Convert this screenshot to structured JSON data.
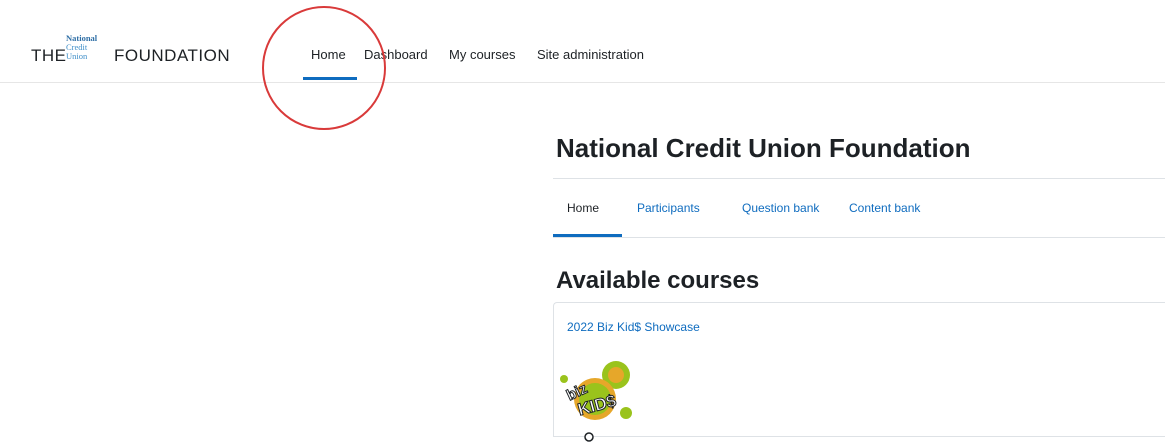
{
  "brand": {
    "the": "THE",
    "name_lines": [
      "National",
      "Credit",
      "Union"
    ],
    "foundation": "FOUNDATION"
  },
  "nav": {
    "items": [
      "Home",
      "Dashboard",
      "My courses",
      "Site administration"
    ],
    "active": "Home"
  },
  "page": {
    "title": "National Credit Union Foundation"
  },
  "secondary_nav": {
    "tabs": [
      "Home",
      "Participants",
      "Question bank",
      "Content bank"
    ],
    "active": "Home"
  },
  "courses": {
    "heading": "Available courses",
    "items": [
      {
        "name": "2022 Biz Kid$ Showcase",
        "logo_text_top": "biz",
        "logo_text_bottom": "KID$"
      }
    ]
  },
  "colors": {
    "accent": "#0f6cbf",
    "annotation": "#d93a3a",
    "logo_green": "#9ac31c",
    "logo_orange": "#e6a72a"
  }
}
